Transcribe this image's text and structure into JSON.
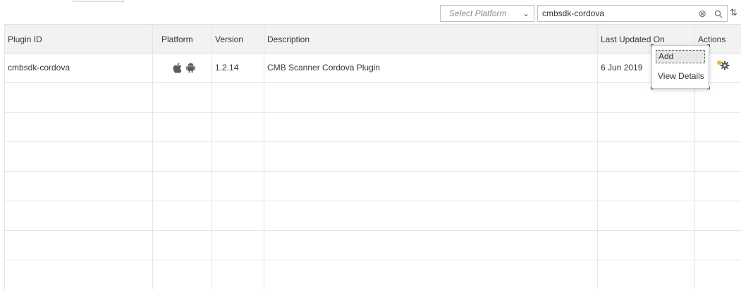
{
  "toolbar": {
    "platform_placeholder": "Select Platform",
    "search_value": "cmbsdk-cordova"
  },
  "table": {
    "columns": [
      "Plugin ID",
      "Platform",
      "Version",
      "Description",
      "Last Updated On",
      "Actions"
    ],
    "rows": [
      {
        "plugin_id": "cmbsdk-cordova",
        "platforms": [
          "apple-icon",
          "android-icon"
        ],
        "version": "1.2.14",
        "description": "CMB Scanner Cordova Plugin",
        "last_updated": "6 Jun 2019",
        "actions_icon": "gear-icon"
      }
    ]
  },
  "actions_menu": {
    "items": [
      "Add",
      "View Details"
    ]
  },
  "icons": {
    "platform_chevron": "chevron-down-icon",
    "clear": "clear-icon",
    "search": "search-icon",
    "sort": "sort-icon"
  },
  "colors": {
    "header_bg": "#f2f2f2",
    "highlight_bg": "#e8e8e8",
    "gear_accent": "#f0b429"
  }
}
